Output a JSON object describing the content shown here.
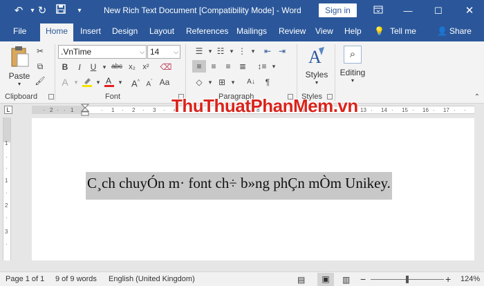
{
  "window": {
    "title": "New Rich Text Document [Compatibility Mode]  -  Word",
    "sign_in": "Sign in"
  },
  "tabs": [
    "File",
    "Home",
    "Insert",
    "Design",
    "Layout",
    "References",
    "Mailings",
    "Review",
    "View",
    "Help"
  ],
  "tell_me": "Tell me",
  "share": "Share",
  "ribbon": {
    "paste_label": "Paste",
    "font_name": ".VnTime",
    "font_size": "14",
    "groups": {
      "clipboard": "Clipboard",
      "font": "Font",
      "paragraph": "Paragraph",
      "styles": "Styles",
      "editing": "Editing"
    },
    "styles_label": "Styles",
    "editing_label": "Editing",
    "bold": "B",
    "italic": "I",
    "underline": "U",
    "strike": "abc",
    "subscript": "x₂",
    "superscript": "x²"
  },
  "document": {
    "text": "C¸ch chuyÓn m· font ch÷ b»ng phÇn mÒm Unikey."
  },
  "watermark": "ThuThuatPhanMem.vn",
  "status": {
    "page": "Page 1 of 1",
    "words": "9 of 9 words",
    "language": "English (United Kingdom)",
    "zoom": "124%",
    "zoom_level": 0.5
  }
}
